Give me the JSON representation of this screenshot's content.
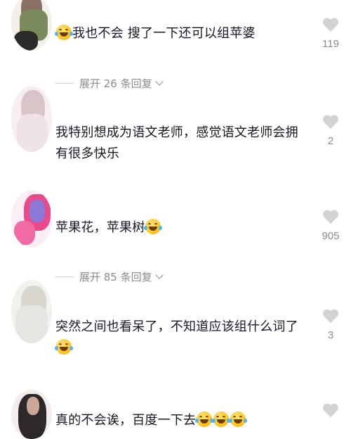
{
  "comments": [
    {
      "text": "我也不会 搜了一下还可以组苹婆",
      "likes": "119"
    },
    {
      "text": "我特别想成为语文老师，感觉语文老师会拥有很多快乐",
      "likes": "2"
    },
    {
      "text": "苹果花，苹果树",
      "likes": "905"
    },
    {
      "text": "突然之间也看呆了，不知道应该组什么词了",
      "likes": "3"
    },
    {
      "text": "真的不会诶，百度一下去",
      "likes": ""
    }
  ],
  "reply_toggles": [
    {
      "label": "展开 26 条回复"
    },
    {
      "label": "展开 85 条回复"
    }
  ],
  "colors": {
    "text": "#161823",
    "secondary": "#8a8b91",
    "heart": "#d2d2d5",
    "emoji": "#ffc928"
  },
  "icons": {
    "like": "heart-icon",
    "expand": "chevron-down-icon",
    "emoji": "laugh-cry-emoji"
  }
}
